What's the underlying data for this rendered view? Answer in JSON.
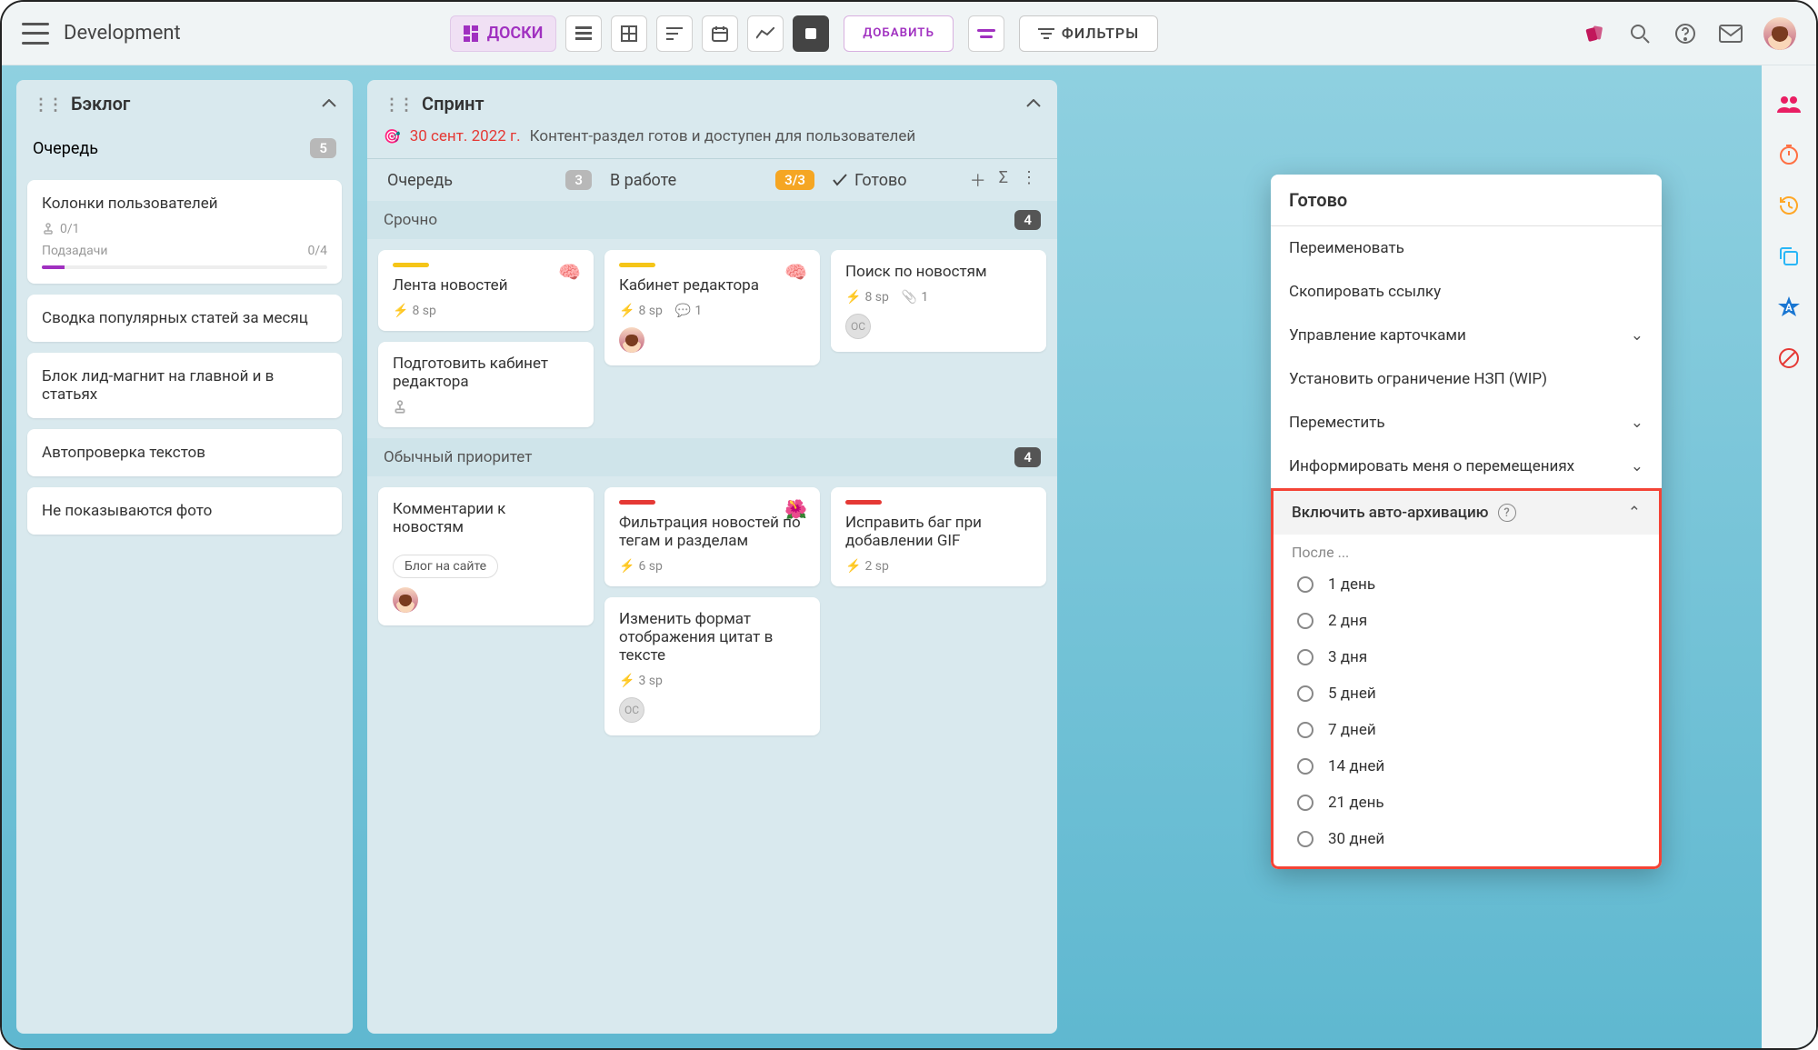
{
  "project_title": "Development",
  "toolbar": {
    "boards_label": "ДОСКИ",
    "add_label": "ДОБАВИТЬ",
    "filters_label": "ФИЛЬТРЫ"
  },
  "backlog": {
    "title": "Бэклог",
    "queue_label": "Очередь",
    "queue_count": "5",
    "cards": [
      {
        "title": "Колонки пользователей",
        "subtasks_done": "0/1",
        "subtasks_label": "Подзадачи",
        "subtasks_total": "0/4",
        "progress_pct": 8
      },
      {
        "title": "Сводка популярных статей за месяц"
      },
      {
        "title": "Блок лид-магнит на главной и в статьях"
      },
      {
        "title": "Автопроверка текстов"
      },
      {
        "title": "Не показываются фото"
      }
    ]
  },
  "sprint": {
    "title": "Спринт",
    "goal_date": "30 сент. 2022 г.",
    "goal_text": "Контент-раздел готов и доступен для пользователей",
    "columns": [
      {
        "label": "Очередь",
        "count": "3"
      },
      {
        "label": "В работе",
        "count": "3/3",
        "count_style": "orange"
      },
      {
        "label": "Готово",
        "check": true
      }
    ],
    "lanes": [
      {
        "label": "Срочно",
        "count": "4",
        "cols": [
          [
            {
              "bar": "yellow",
              "title": "Лента новостей",
              "emoji": "brain",
              "sp": "8 sp"
            },
            {
              "title": "Подготовить кабинет редактора",
              "fork": true
            }
          ],
          [
            {
              "bar": "yellow",
              "title": "Кабинет редактора",
              "emoji": "brain",
              "sp": "8 sp",
              "comments": "1",
              "avatar": true
            }
          ],
          [
            {
              "title": "Поиск по новостям",
              "sp": "8 sp",
              "clip": "1",
              "circle": "ОС"
            }
          ]
        ]
      },
      {
        "label": "Обычный приоритет",
        "count": "4",
        "cols": [
          [
            {
              "title": "Комментарии к новостям",
              "tag": "Блог на сайте",
              "avatar": true
            }
          ],
          [
            {
              "bar": "red",
              "title": "Фильтрация новостей по тегам и разделам",
              "emoji": "flower",
              "sp": "6 sp"
            },
            {
              "title": "Изменить формат отображения цитат в тексте",
              "sp": "3 sp",
              "circle": "ОС"
            }
          ],
          [
            {
              "bar": "red",
              "title": "Исправить баг при добавлении GIF",
              "sp": "2 sp"
            }
          ]
        ]
      }
    ]
  },
  "popup": {
    "title": "Готово",
    "items": [
      {
        "label": "Переименовать"
      },
      {
        "label": "Скопировать ссылку"
      },
      {
        "label": "Управление карточками",
        "chev": "down"
      },
      {
        "label": "Установить ограничение НЗП (WIP)"
      },
      {
        "label": "Переместить",
        "chev": "down"
      },
      {
        "label": "Информировать меня о перемещениях",
        "chev": "down"
      }
    ],
    "auto_label": "Включить авто-архивацию",
    "after_label": "После ...",
    "options": [
      "1 день",
      "2 дня",
      "3 дня",
      "5 дней",
      "7 дней",
      "14 дней",
      "21 день",
      "30 дней"
    ]
  }
}
